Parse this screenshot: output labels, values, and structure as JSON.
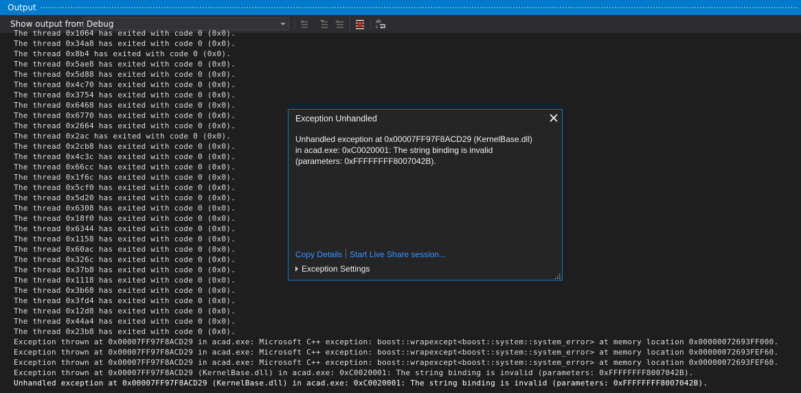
{
  "panel": {
    "title": "Output"
  },
  "toolbar": {
    "show_output_label": "Show output from:",
    "source_selected": "Debug",
    "buttons": [
      {
        "icon": "go-to-previous-message-icon"
      },
      {
        "icon": "go-to-next-message-icon"
      },
      {
        "icon": "go-to-end-icon"
      },
      {
        "icon": "clear-all-icon"
      },
      {
        "icon": "toggle-word-wrap-icon"
      }
    ]
  },
  "log_lines": [
    "The thread 0x1064 has exited with code 0 (0x0).",
    "The thread 0x34a8 has exited with code 0 (0x0).",
    "The thread 0x8b4 has exited with code 0 (0x0).",
    "The thread 0x5ae8 has exited with code 0 (0x0).",
    "The thread 0x5d88 has exited with code 0 (0x0).",
    "The thread 0x4c70 has exited with code 0 (0x0).",
    "The thread 0x3754 has exited with code 0 (0x0).",
    "The thread 0x6468 has exited with code 0 (0x0).",
    "The thread 0x6770 has exited with code 0 (0x0).",
    "The thread 0x2664 has exited with code 0 (0x0).",
    "The thread 0x2ac has exited with code 0 (0x0).",
    "The thread 0x2cb8 has exited with code 0 (0x0).",
    "The thread 0x4c3c has exited with code 0 (0x0).",
    "The thread 0x66cc has exited with code 0 (0x0).",
    "The thread 0x1f6c has exited with code 0 (0x0).",
    "The thread 0x5cf0 has exited with code 0 (0x0).",
    "The thread 0x5d20 has exited with code 0 (0x0).",
    "The thread 0x6308 has exited with code 0 (0x0).",
    "The thread 0x18f0 has exited with code 0 (0x0).",
    "The thread 0x6344 has exited with code 0 (0x0).",
    "The thread 0x1158 has exited with code 0 (0x0).",
    "The thread 0x60ac has exited with code 0 (0x0).",
    "The thread 0x326c has exited with code 0 (0x0).",
    "The thread 0x37b8 has exited with code 0 (0x0).",
    "The thread 0x1118 has exited with code 0 (0x0).",
    "The thread 0x3b68 has exited with code 0 (0x0).",
    "The thread 0x3fd4 has exited with code 0 (0x0).",
    "The thread 0x12d8 has exited with code 0 (0x0).",
    "The thread 0x44a4 has exited with code 0 (0x0).",
    "The thread 0x23b8 has exited with code 0 (0x0).",
    "Exception thrown at 0x00007FF97F8ACD29 in acad.exe: Microsoft C++ exception: boost::wrapexcept<boost::system::system_error> at memory location 0x00000072693FF000.",
    "Exception thrown at 0x00007FF97F8ACD29 in acad.exe: Microsoft C++ exception: boost::wrapexcept<boost::system::system_error> at memory location 0x00000072693FEF60.",
    "Exception thrown at 0x00007FF97F8ACD29 in acad.exe: Microsoft C++ exception: boost::wrapexcept<boost::system::system_error> at memory location 0x00000072693FEF60.",
    "Exception thrown at 0x00007FF97F8ACD29 (KernelBase.dll) in acad.exe: 0xC0020001: The string binding is invalid (parameters: 0xFFFFFFFF8007042B).",
    "Unhandled exception at 0x00007FF97F8ACD29 (KernelBase.dll) in acad.exe: 0xC0020001: The string binding is invalid (parameters: 0xFFFFFFFF8007042B)."
  ],
  "dialog": {
    "title": "Exception Unhandled",
    "message": "Unhandled exception at 0x00007FF97F8ACD29 (KernelBase.dll) in acad.exe: 0xC0020001: The string binding is invalid (parameters: 0xFFFFFFFF8007042B).",
    "copy_details": "Copy Details",
    "live_share": "Start Live Share session...",
    "exception_settings": "Exception Settings"
  },
  "colors": {
    "accent": "#007acc",
    "background": "#1e1e1e",
    "toolbar": "#2d2d30",
    "link": "#3794ff"
  }
}
